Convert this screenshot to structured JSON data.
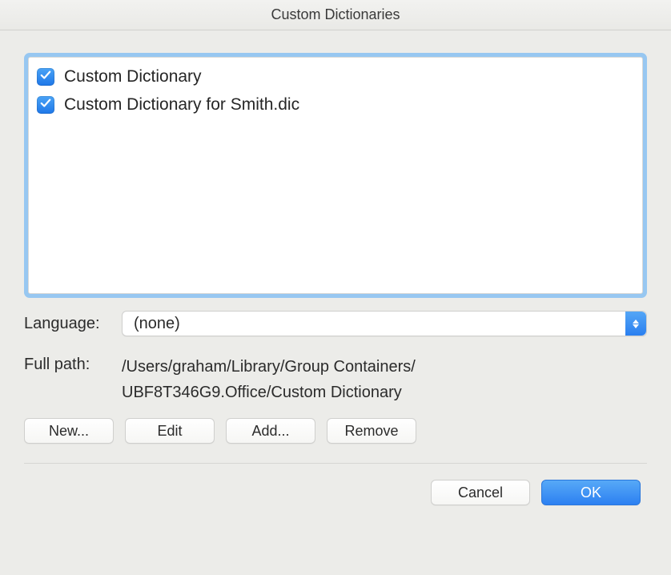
{
  "title": "Custom Dictionaries",
  "dictionaries": [
    {
      "checked": true,
      "label": "Custom Dictionary"
    },
    {
      "checked": true,
      "label": "Custom Dictionary for Smith.dic"
    }
  ],
  "language": {
    "label": "Language:",
    "selected": "(none)"
  },
  "fullpath": {
    "label": "Full path:",
    "line1": "/Users/graham/Library/Group Containers/",
    "line2": "UBF8T346G9.Office/Custom Dictionary"
  },
  "buttons": {
    "new": "New...",
    "edit": "Edit",
    "add": "Add...",
    "remove": "Remove",
    "cancel": "Cancel",
    "ok": "OK"
  }
}
